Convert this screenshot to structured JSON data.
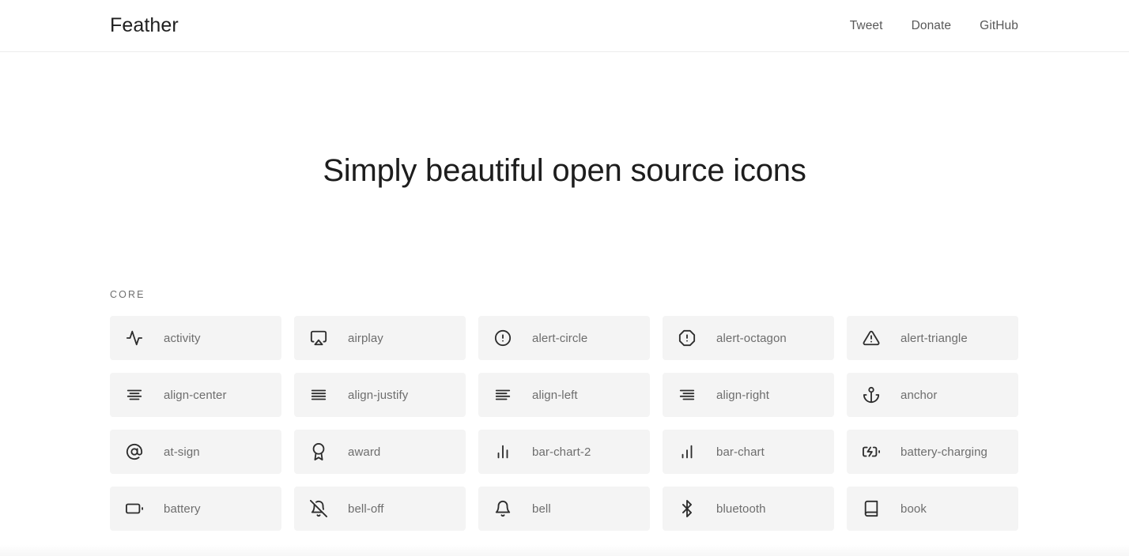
{
  "header": {
    "wordmark": "Feather",
    "nav": [
      {
        "label": "Tweet",
        "name": "nav-link-tweet"
      },
      {
        "label": "Donate",
        "name": "nav-link-donate"
      },
      {
        "label": "GitHub",
        "name": "nav-link-github"
      }
    ]
  },
  "hero": {
    "title": "Simply beautiful open source icons"
  },
  "section": {
    "label": "CORE",
    "icons": [
      {
        "label": "activity",
        "icon": "activity-icon"
      },
      {
        "label": "airplay",
        "icon": "airplay-icon"
      },
      {
        "label": "alert-circle",
        "icon": "alert-circle-icon"
      },
      {
        "label": "alert-octagon",
        "icon": "alert-octagon-icon"
      },
      {
        "label": "alert-triangle",
        "icon": "alert-triangle-icon"
      },
      {
        "label": "align-center",
        "icon": "align-center-icon"
      },
      {
        "label": "align-justify",
        "icon": "align-justify-icon"
      },
      {
        "label": "align-left",
        "icon": "align-left-icon"
      },
      {
        "label": "align-right",
        "icon": "align-right-icon"
      },
      {
        "label": "anchor",
        "icon": "anchor-icon"
      },
      {
        "label": "at-sign",
        "icon": "at-sign-icon"
      },
      {
        "label": "award",
        "icon": "award-icon"
      },
      {
        "label": "bar-chart-2",
        "icon": "bar-chart-2-icon"
      },
      {
        "label": "bar-chart",
        "icon": "bar-chart-icon"
      },
      {
        "label": "battery-charging",
        "icon": "battery-charging-icon"
      },
      {
        "label": "battery",
        "icon": "battery-icon"
      },
      {
        "label": "bell-off",
        "icon": "bell-off-icon"
      },
      {
        "label": "bell",
        "icon": "bell-icon"
      },
      {
        "label": "bluetooth",
        "icon": "bluetooth-icon"
      },
      {
        "label": "book",
        "icon": "book-icon"
      }
    ]
  },
  "colors": {
    "card_background": "#f4f4f4",
    "icon_stroke": "#2d2d2d",
    "label_text": "#6d6d6d",
    "heading_text": "#1d1d1d",
    "nav_text": "#595959"
  }
}
